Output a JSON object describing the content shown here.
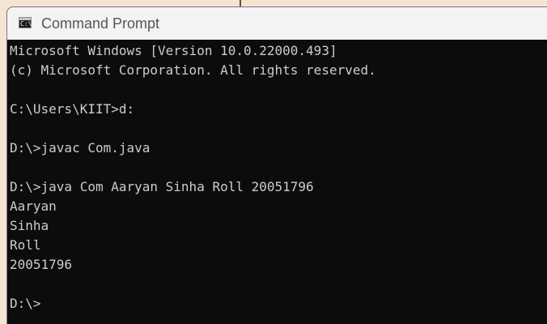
{
  "window": {
    "title": "Command Prompt",
    "icon": "command-prompt-icon",
    "icon_text": "C:\\."
  },
  "console": {
    "lines": [
      "Microsoft Windows [Version 10.0.22000.493]",
      "(c) Microsoft Corporation. All rights reserved.",
      "",
      "C:\\Users\\KIIT>d:",
      "",
      "D:\\>javac Com.java",
      "",
      "D:\\>java Com Aaryan Sinha Roll 20051796",
      "Aaryan",
      "Sinha",
      "Roll",
      "20051796",
      "",
      "D:\\>"
    ]
  },
  "colors": {
    "titlebar": "#f3f3f3",
    "console_background": "#0c0c0c",
    "console_text": "#cccccc",
    "desktop": "#f4e4d0"
  }
}
